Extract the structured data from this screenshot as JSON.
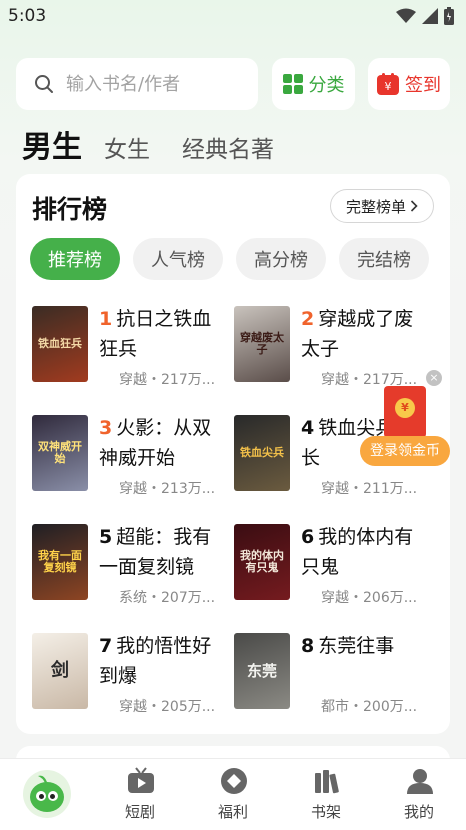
{
  "status_bar": {
    "time": "5:03"
  },
  "search": {
    "placeholder": "输入书名/作者"
  },
  "top_buttons": {
    "category": "分类",
    "checkin": "签到",
    "checkin_icon_char": "¥"
  },
  "gender_tabs": [
    {
      "label": "男生",
      "active": true
    },
    {
      "label": "女生",
      "active": false
    },
    {
      "label": "经典名著",
      "active": false
    }
  ],
  "ranking": {
    "title": "排行榜",
    "full_list": "完整榜单",
    "tabs": [
      {
        "label": "推荐榜",
        "active": true
      },
      {
        "label": "人气榜",
        "active": false
      },
      {
        "label": "高分榜",
        "active": false
      },
      {
        "label": "完结榜",
        "active": false
      }
    ],
    "books": [
      {
        "rank": "1",
        "title": "抗日之铁血狂兵",
        "meta": "穿越・217万...",
        "cover_text": "铁血狂兵",
        "colors": [
          "#3a2c24",
          "#a23b1f"
        ]
      },
      {
        "rank": "2",
        "title": "穿越成了废太子",
        "meta": "穿越・217万...",
        "cover_text": "穿越废太子",
        "colors": [
          "#c9c3bd",
          "#5a4d49"
        ]
      },
      {
        "rank": "3",
        "title": "火影：从双神威开始",
        "meta": "穿越・213万...",
        "cover_text": "双神威开始",
        "colors": [
          "#302a3c",
          "#8a8fa8"
        ]
      },
      {
        "rank": "4",
        "title": "铁血尖兵从长",
        "meta": "穿越・211万...",
        "cover_text": "铁血尖兵",
        "colors": [
          "#28292a",
          "#6b5b3f"
        ]
      },
      {
        "rank": "5",
        "title": "超能：我有一面复刻镜",
        "meta": "系统・207万...",
        "cover_text": "我有一面复刻镜",
        "colors": [
          "#1f1f24",
          "#8e4523"
        ]
      },
      {
        "rank": "6",
        "title": "我的体内有只鬼",
        "meta": "穿越・206万...",
        "cover_text": "我的体内有只鬼",
        "colors": [
          "#3a0d12",
          "#751b1f"
        ]
      },
      {
        "rank": "7",
        "title": "我的悟性好到爆",
        "meta": "穿越・205万...",
        "cover_text": "剑",
        "colors": [
          "#f4efe7",
          "#c9b8a6"
        ]
      },
      {
        "rank": "8",
        "title": "东莞往事",
        "meta": "都市・200万...",
        "cover_text": "东莞",
        "colors": [
          "#4a4a48",
          "#8b8a84"
        ]
      }
    ]
  },
  "red_packet": {
    "label": "登录领金币",
    "close": "×",
    "coin": "¥"
  },
  "bottom_nav": [
    {
      "label": "",
      "icon": "home-mascot-icon"
    },
    {
      "label": "短剧",
      "icon": "tv-icon"
    },
    {
      "label": "福利",
      "icon": "gift-diamond-icon"
    },
    {
      "label": "书架",
      "icon": "bookshelf-icon"
    },
    {
      "label": "我的",
      "icon": "profile-icon"
    }
  ],
  "colors": {
    "accent_green": "#45b04a",
    "rank_orange": "#f0632c",
    "checkin_red": "#e8352c",
    "redpacket_orange": "#f9a73f"
  }
}
